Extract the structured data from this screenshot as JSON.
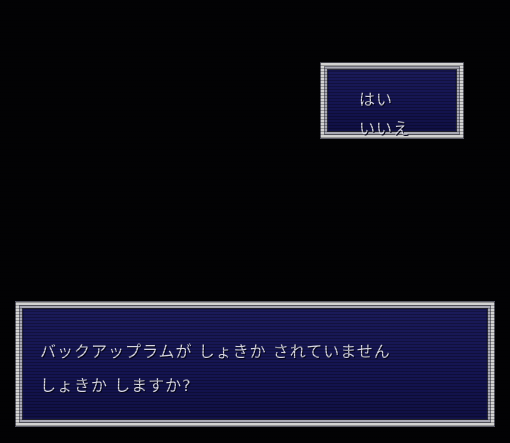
{
  "choices": {
    "yes_label": "はい",
    "no_label": "いいえ"
  },
  "message": {
    "line1": "バックアップラムが しょきか されていません",
    "line2": "しょきか しますか?"
  },
  "colors": {
    "background": "#000000",
    "window_fill": "#14144e",
    "window_border": "#d2d2d2",
    "text": "#d6d6e4"
  }
}
